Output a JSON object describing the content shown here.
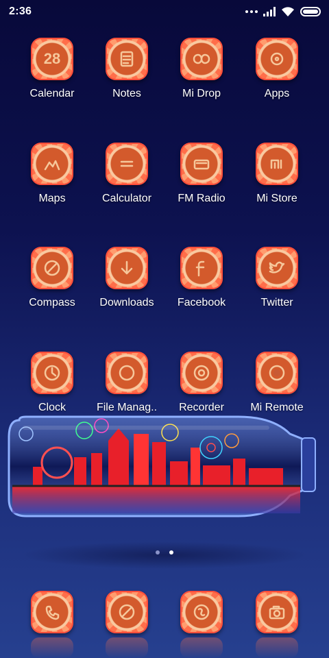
{
  "status_bar": {
    "time": "2:36",
    "icons": [
      "more-dots-icon",
      "cellular-signal-icon",
      "wifi-icon",
      "battery-icon"
    ]
  },
  "apps": [
    {
      "label": "Calendar",
      "icon": "calendar-icon",
      "glyph": "28"
    },
    {
      "label": "Notes",
      "icon": "notes-icon"
    },
    {
      "label": "Mi Drop",
      "icon": "infinity-icon"
    },
    {
      "label": "Apps",
      "icon": "apps-icon"
    },
    {
      "label": "Maps",
      "icon": "map-icon"
    },
    {
      "label": "Calculator",
      "icon": "calculator-icon"
    },
    {
      "label": "FM Radio",
      "icon": "radio-icon"
    },
    {
      "label": "Mi Store",
      "icon": "mi-logo-icon"
    },
    {
      "label": "Compass",
      "icon": "compass-icon"
    },
    {
      "label": "Downloads",
      "icon": "download-arrow-icon"
    },
    {
      "label": "Facebook",
      "icon": "facebook-icon"
    },
    {
      "label": "Twitter",
      "icon": "twitter-bird-icon"
    },
    {
      "label": "Clock",
      "icon": "clock-icon"
    },
    {
      "label": "File Manag..",
      "icon": "folder-icon"
    },
    {
      "label": "Recorder",
      "icon": "recorder-icon"
    },
    {
      "label": "Mi Remote",
      "icon": "remote-icon"
    }
  ],
  "widget": {
    "name": "bottle-city-widget"
  },
  "page_indicator": {
    "current": 2,
    "total": 2
  },
  "dock": [
    {
      "icon": "phone-icon"
    },
    {
      "icon": "browser-compass-icon"
    },
    {
      "icon": "messaging-icon"
    },
    {
      "icon": "camera-icon"
    }
  ],
  "colors": {
    "icon_base": "#ff6e4a",
    "icon_center": "#d35a2c",
    "glyph": "#f6c79b",
    "background_top": "#08093a",
    "background_bottom": "#26408f"
  }
}
